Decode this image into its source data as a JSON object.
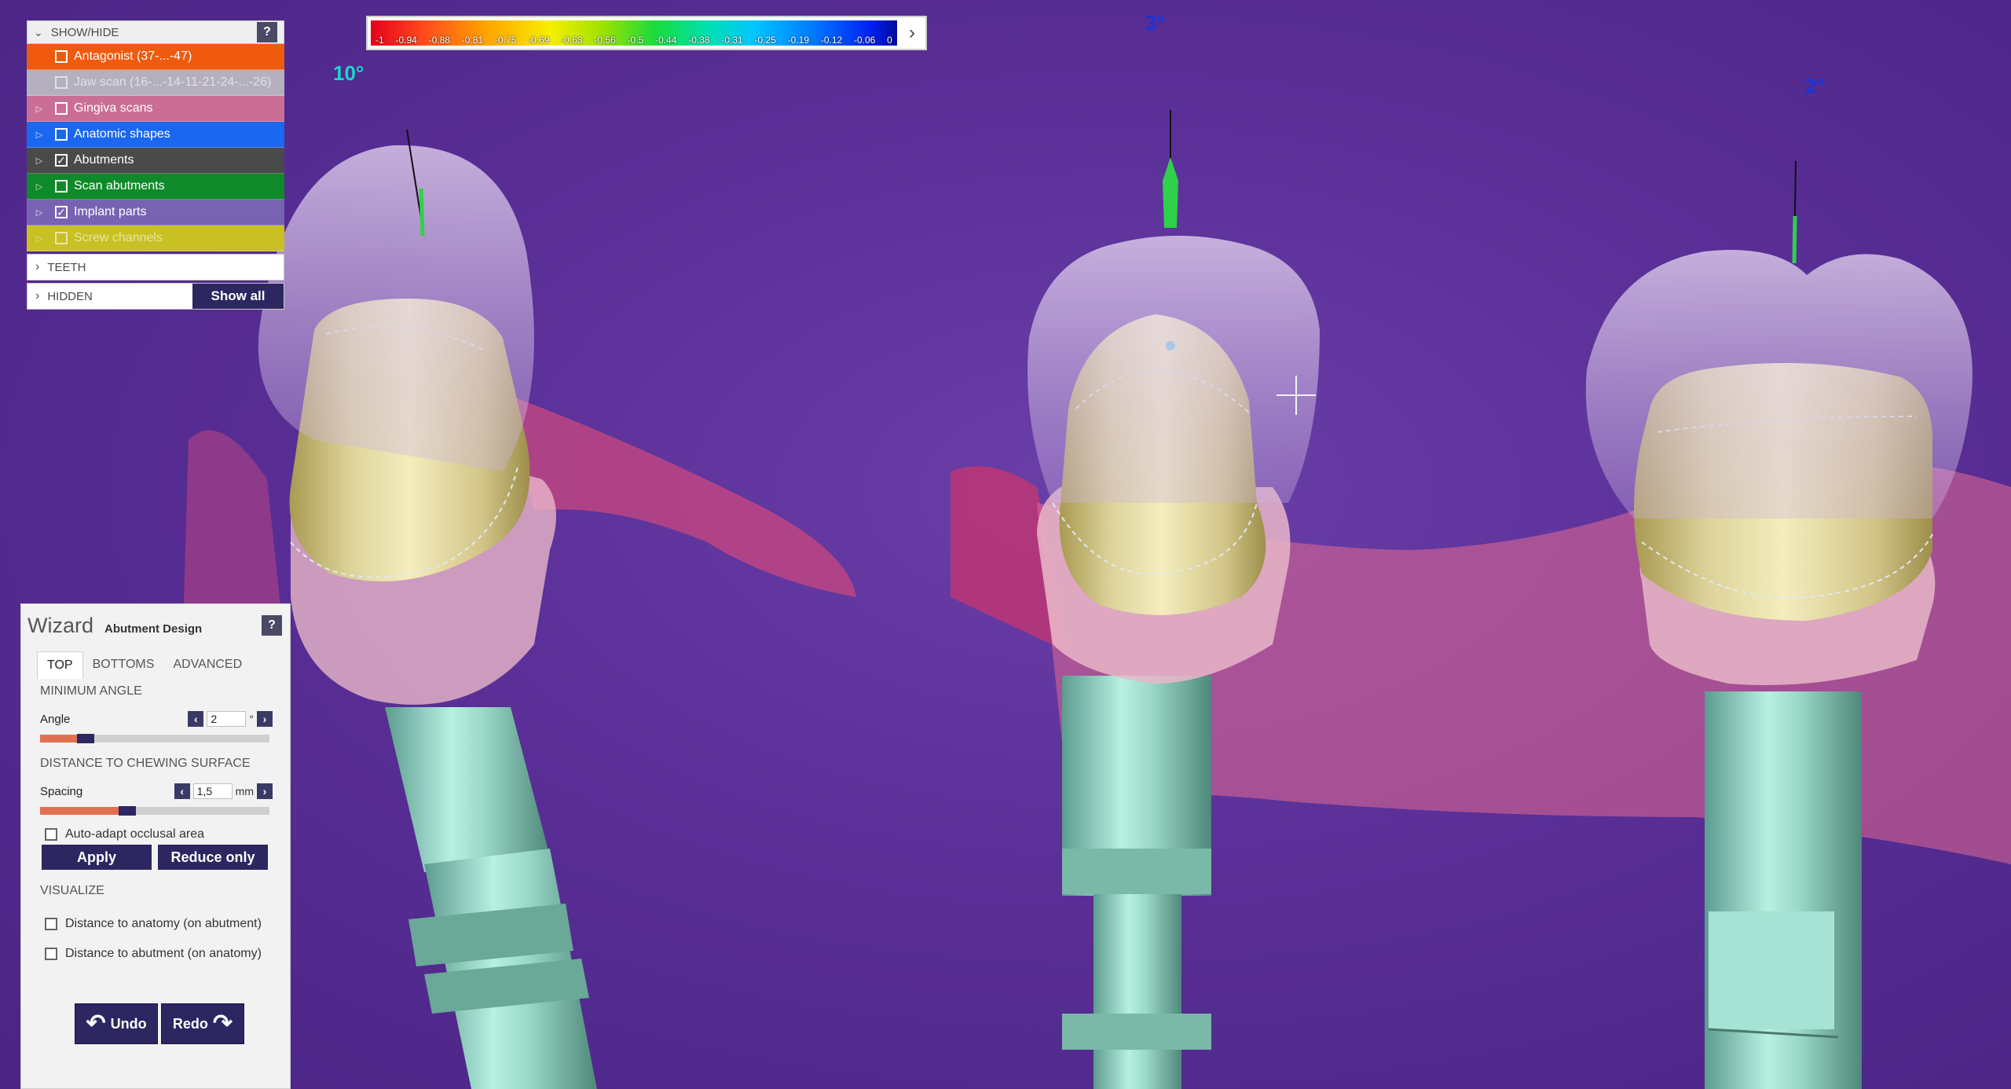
{
  "color_scale": {
    "ticks": [
      "-1",
      "-0.94",
      "-0.88",
      "-0.81",
      "-0.75",
      "-0.69",
      "-0.63",
      "-0.56",
      "-0.5",
      "-0.44",
      "-0.38",
      "-0.31",
      "-0.25",
      "-0.19",
      "-0.12",
      "-0.06",
      "0"
    ],
    "expand_icon": "chevron-right-icon"
  },
  "angles": {
    "left": "10°",
    "middle": "3°",
    "right": "2°"
  },
  "angle_colors": {
    "left": "#19d7c8",
    "middle": "#1a33d8",
    "right": "#1a33d8"
  },
  "show_hide": {
    "header": "SHOW/HIDE",
    "help": "?",
    "items": [
      {
        "label": "Antagonist (37-...-47)",
        "checked": false,
        "expandable": false,
        "color": "#ef5a0e",
        "dim": false
      },
      {
        "label": "Jaw scan (16-...-14-11-21-24-...-26)",
        "checked": false,
        "expandable": false,
        "color": "#b5b0c0",
        "dim": true
      },
      {
        "label": "Gingiva scans",
        "checked": false,
        "expandable": true,
        "color": "#cb6e95",
        "dim": false
      },
      {
        "label": "Anatomic shapes",
        "checked": false,
        "expandable": true,
        "color": "#1a67f0",
        "dim": false
      },
      {
        "label": "Abutments",
        "checked": true,
        "expandable": true,
        "color": "#4a4a4a",
        "dim": false
      },
      {
        "label": "Scan abutments",
        "checked": false,
        "expandable": true,
        "color": "#0f8a2a",
        "dim": false
      },
      {
        "label": "Implant parts",
        "checked": true,
        "expandable": true,
        "color": "#7863b3",
        "dim": false
      },
      {
        "label": "Screw channels",
        "checked": false,
        "expandable": true,
        "color": "#c9c023",
        "dim": true
      }
    ],
    "teeth": "TEETH",
    "hidden": "HIDDEN",
    "show_all": "Show all"
  },
  "wizard": {
    "title": "Wizard",
    "subtitle": "Abutment Design",
    "help": "?",
    "tabs": [
      "TOP",
      "BOTTOMS",
      "ADVANCED"
    ],
    "active_tab": "TOP",
    "min_angle_section": "MINIMUM ANGLE",
    "angle": {
      "label": "Angle",
      "value": "2",
      "unit": "°",
      "slider_fraction": 0.2
    },
    "distance_section": "DISTANCE TO CHEWING SURFACE",
    "spacing": {
      "label": "Spacing",
      "value": "1,5",
      "unit": "mm",
      "slider_fraction": 0.38
    },
    "auto_adapt": {
      "label": "Auto-adapt occlusal area",
      "checked": false
    },
    "apply": "Apply",
    "reduce_only": "Reduce only",
    "visualize_section": "VISUALIZE",
    "vis_options": [
      {
        "label": "Distance to anatomy (on abutment)",
        "checked": false
      },
      {
        "label": "Distance to abutment (on anatomy)",
        "checked": false
      }
    ],
    "undo": "Undo",
    "redo": "Redo"
  }
}
